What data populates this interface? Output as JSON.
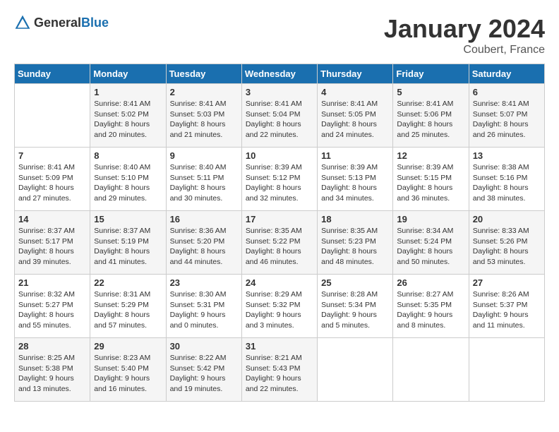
{
  "header": {
    "logo_general": "General",
    "logo_blue": "Blue",
    "month_title": "January 2024",
    "location": "Coubert, France"
  },
  "weekdays": [
    "Sunday",
    "Monday",
    "Tuesday",
    "Wednesday",
    "Thursday",
    "Friday",
    "Saturday"
  ],
  "weeks": [
    [
      {
        "day": "",
        "sunrise": "",
        "sunset": "",
        "daylight": ""
      },
      {
        "day": "1",
        "sunrise": "Sunrise: 8:41 AM",
        "sunset": "Sunset: 5:02 PM",
        "daylight": "Daylight: 8 hours and 20 minutes."
      },
      {
        "day": "2",
        "sunrise": "Sunrise: 8:41 AM",
        "sunset": "Sunset: 5:03 PM",
        "daylight": "Daylight: 8 hours and 21 minutes."
      },
      {
        "day": "3",
        "sunrise": "Sunrise: 8:41 AM",
        "sunset": "Sunset: 5:04 PM",
        "daylight": "Daylight: 8 hours and 22 minutes."
      },
      {
        "day": "4",
        "sunrise": "Sunrise: 8:41 AM",
        "sunset": "Sunset: 5:05 PM",
        "daylight": "Daylight: 8 hours and 24 minutes."
      },
      {
        "day": "5",
        "sunrise": "Sunrise: 8:41 AM",
        "sunset": "Sunset: 5:06 PM",
        "daylight": "Daylight: 8 hours and 25 minutes."
      },
      {
        "day": "6",
        "sunrise": "Sunrise: 8:41 AM",
        "sunset": "Sunset: 5:07 PM",
        "daylight": "Daylight: 8 hours and 26 minutes."
      }
    ],
    [
      {
        "day": "7",
        "sunrise": "Sunrise: 8:41 AM",
        "sunset": "Sunset: 5:09 PM",
        "daylight": "Daylight: 8 hours and 27 minutes."
      },
      {
        "day": "8",
        "sunrise": "Sunrise: 8:40 AM",
        "sunset": "Sunset: 5:10 PM",
        "daylight": "Daylight: 8 hours and 29 minutes."
      },
      {
        "day": "9",
        "sunrise": "Sunrise: 8:40 AM",
        "sunset": "Sunset: 5:11 PM",
        "daylight": "Daylight: 8 hours and 30 minutes."
      },
      {
        "day": "10",
        "sunrise": "Sunrise: 8:39 AM",
        "sunset": "Sunset: 5:12 PM",
        "daylight": "Daylight: 8 hours and 32 minutes."
      },
      {
        "day": "11",
        "sunrise": "Sunrise: 8:39 AM",
        "sunset": "Sunset: 5:13 PM",
        "daylight": "Daylight: 8 hours and 34 minutes."
      },
      {
        "day": "12",
        "sunrise": "Sunrise: 8:39 AM",
        "sunset": "Sunset: 5:15 PM",
        "daylight": "Daylight: 8 hours and 36 minutes."
      },
      {
        "day": "13",
        "sunrise": "Sunrise: 8:38 AM",
        "sunset": "Sunset: 5:16 PM",
        "daylight": "Daylight: 8 hours and 38 minutes."
      }
    ],
    [
      {
        "day": "14",
        "sunrise": "Sunrise: 8:37 AM",
        "sunset": "Sunset: 5:17 PM",
        "daylight": "Daylight: 8 hours and 39 minutes."
      },
      {
        "day": "15",
        "sunrise": "Sunrise: 8:37 AM",
        "sunset": "Sunset: 5:19 PM",
        "daylight": "Daylight: 8 hours and 41 minutes."
      },
      {
        "day": "16",
        "sunrise": "Sunrise: 8:36 AM",
        "sunset": "Sunset: 5:20 PM",
        "daylight": "Daylight: 8 hours and 44 minutes."
      },
      {
        "day": "17",
        "sunrise": "Sunrise: 8:35 AM",
        "sunset": "Sunset: 5:22 PM",
        "daylight": "Daylight: 8 hours and 46 minutes."
      },
      {
        "day": "18",
        "sunrise": "Sunrise: 8:35 AM",
        "sunset": "Sunset: 5:23 PM",
        "daylight": "Daylight: 8 hours and 48 minutes."
      },
      {
        "day": "19",
        "sunrise": "Sunrise: 8:34 AM",
        "sunset": "Sunset: 5:24 PM",
        "daylight": "Daylight: 8 hours and 50 minutes."
      },
      {
        "day": "20",
        "sunrise": "Sunrise: 8:33 AM",
        "sunset": "Sunset: 5:26 PM",
        "daylight": "Daylight: 8 hours and 53 minutes."
      }
    ],
    [
      {
        "day": "21",
        "sunrise": "Sunrise: 8:32 AM",
        "sunset": "Sunset: 5:27 PM",
        "daylight": "Daylight: 8 hours and 55 minutes."
      },
      {
        "day": "22",
        "sunrise": "Sunrise: 8:31 AM",
        "sunset": "Sunset: 5:29 PM",
        "daylight": "Daylight: 8 hours and 57 minutes."
      },
      {
        "day": "23",
        "sunrise": "Sunrise: 8:30 AM",
        "sunset": "Sunset: 5:31 PM",
        "daylight": "Daylight: 9 hours and 0 minutes."
      },
      {
        "day": "24",
        "sunrise": "Sunrise: 8:29 AM",
        "sunset": "Sunset: 5:32 PM",
        "daylight": "Daylight: 9 hours and 3 minutes."
      },
      {
        "day": "25",
        "sunrise": "Sunrise: 8:28 AM",
        "sunset": "Sunset: 5:34 PM",
        "daylight": "Daylight: 9 hours and 5 minutes."
      },
      {
        "day": "26",
        "sunrise": "Sunrise: 8:27 AM",
        "sunset": "Sunset: 5:35 PM",
        "daylight": "Daylight: 9 hours and 8 minutes."
      },
      {
        "day": "27",
        "sunrise": "Sunrise: 8:26 AM",
        "sunset": "Sunset: 5:37 PM",
        "daylight": "Daylight: 9 hours and 11 minutes."
      }
    ],
    [
      {
        "day": "28",
        "sunrise": "Sunrise: 8:25 AM",
        "sunset": "Sunset: 5:38 PM",
        "daylight": "Daylight: 9 hours and 13 minutes."
      },
      {
        "day": "29",
        "sunrise": "Sunrise: 8:23 AM",
        "sunset": "Sunset: 5:40 PM",
        "daylight": "Daylight: 9 hours and 16 minutes."
      },
      {
        "day": "30",
        "sunrise": "Sunrise: 8:22 AM",
        "sunset": "Sunset: 5:42 PM",
        "daylight": "Daylight: 9 hours and 19 minutes."
      },
      {
        "day": "31",
        "sunrise": "Sunrise: 8:21 AM",
        "sunset": "Sunset: 5:43 PM",
        "daylight": "Daylight: 9 hours and 22 minutes."
      },
      {
        "day": "",
        "sunrise": "",
        "sunset": "",
        "daylight": ""
      },
      {
        "day": "",
        "sunrise": "",
        "sunset": "",
        "daylight": ""
      },
      {
        "day": "",
        "sunrise": "",
        "sunset": "",
        "daylight": ""
      }
    ]
  ]
}
